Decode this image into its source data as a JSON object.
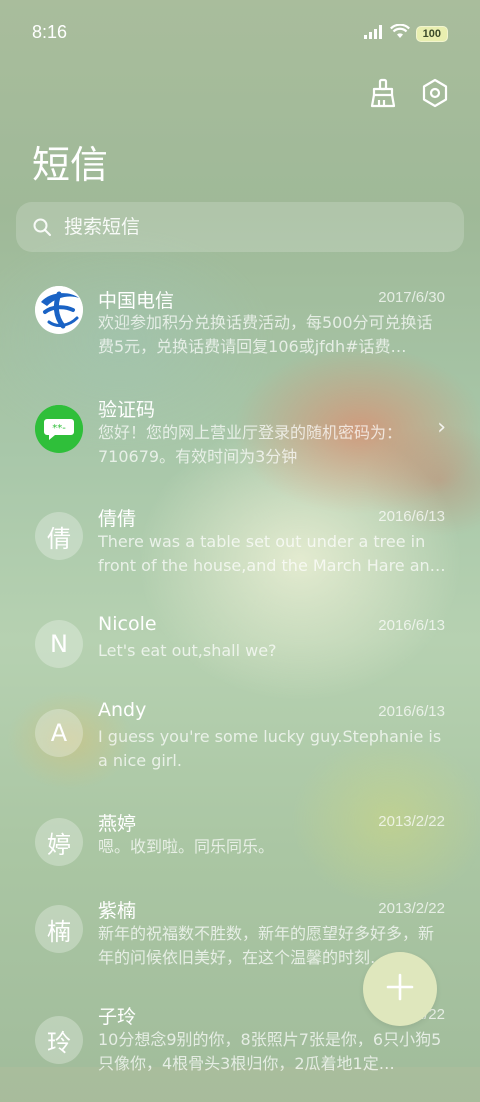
{
  "status_bar": {
    "time": "8:16",
    "battery": "100"
  },
  "header": {
    "title": "短信"
  },
  "search": {
    "placeholder": "搜索短信"
  },
  "conversations": [
    {
      "name": "中国电信",
      "date": "2017/6/30",
      "preview": "欢迎参加积分兑换话费活动，每500分可兑换话费5元，兑换话费请回复106或jfdh#话费…",
      "avatar_type": "china-telecom-logo"
    },
    {
      "name": "验证码",
      "date": "",
      "preview": "您好！您的网上营业厅登录的随机密码为：710679。有效时间为3分钟",
      "avatar_type": "message-icon"
    },
    {
      "name": "倩倩",
      "date": "2016/6/13",
      "preview": "There was a table set out under a tree in front of the house,and the March Hare an…",
      "avatar_letter": "倩"
    },
    {
      "name": "Nicole",
      "date": "2016/6/13",
      "preview": "Let's eat out,shall we?",
      "avatar_letter": "N"
    },
    {
      "name": "Andy",
      "date": "2016/6/13",
      "preview": "I guess you're some lucky guy.Stephanie is a nice girl.",
      "avatar_letter": "A"
    },
    {
      "name": "燕婷",
      "date": "2013/2/22",
      "preview": "嗯。收到啦。同乐同乐。",
      "avatar_letter": "婷"
    },
    {
      "name": "紫楠",
      "date": "2013/2/22",
      "preview": "新年的祝福数不胜数，新年的愿望好多好多，新年的问候依旧美好，在这个温馨的时刻…",
      "avatar_letter": "楠"
    },
    {
      "name": "子玲",
      "date": "2013/2/22",
      "preview": "10分想念9别的你，8张照片7张是你，6只小狗5只像你，4根骨头3根归你，2瓜着地1定…",
      "avatar_letter": "玲"
    }
  ],
  "colors": {
    "telecom_blue": "#1a63c5",
    "message_green": "#2fbf3a",
    "fab_bg": "#dfe7bd"
  }
}
